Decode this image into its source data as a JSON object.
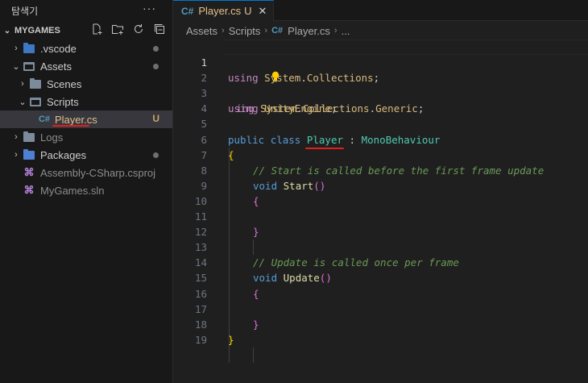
{
  "sidebar": {
    "title": "탐색기",
    "more": "···",
    "workspace": "MYGAMES",
    "items": [
      {
        "label": ".vscode",
        "dim": false
      },
      {
        "label": "Assets"
      },
      {
        "label": "Scenes"
      },
      {
        "label": "Scripts"
      },
      {
        "label": "Player.cs",
        "badge": "U"
      },
      {
        "label": "Logs"
      },
      {
        "label": "Packages"
      },
      {
        "label": "Assembly-CSharp.csproj"
      },
      {
        "label": "MyGames.sln"
      }
    ],
    "cs_glyph": "C#",
    "vs_glyph": "⌘"
  },
  "editor": {
    "tab": {
      "lang": "C#",
      "name": "Player.cs",
      "status": "U",
      "close": "✕"
    },
    "breadcrumbs": [
      "Assets",
      "Scripts",
      "Player.cs",
      "..."
    ],
    "line_numbers": [
      "1",
      "2",
      "3",
      "4",
      "5",
      "6",
      "7",
      "8",
      "9",
      "10",
      "11",
      "12",
      "13",
      "14",
      "15",
      "16",
      "17",
      "18",
      "19"
    ],
    "code": {
      "l1_kw": "using",
      "l1_ns1": "System",
      "l1_ns2": "Collections",
      "l2_rest": "ing",
      "l2_ns1": "System",
      "l2_ns2": "Collections",
      "l2_ns3": "Generic",
      "l3_kw": "using",
      "l3_ns": "UnityEngine",
      "l5_kw1": "public",
      "l5_kw2": "class",
      "l5_name": "Player",
      "l5_colon": " : ",
      "l5_base": "MonoBehaviour",
      "l6": "{",
      "l7": "// Start is called before the first frame update",
      "l8_kw": "void",
      "l8_fn": "Start",
      "l8_p": "()",
      "l9": "{",
      "l11": "}",
      "l13": "// Update is called once per frame",
      "l14_kw": "void",
      "l14_fn": "Update",
      "l14_p": "()",
      "l15": "{",
      "l17": "}",
      "l18": "}"
    }
  },
  "colors": {
    "accent": "#0078d4",
    "modified": "#e2c08d",
    "underline": "#e02020"
  }
}
